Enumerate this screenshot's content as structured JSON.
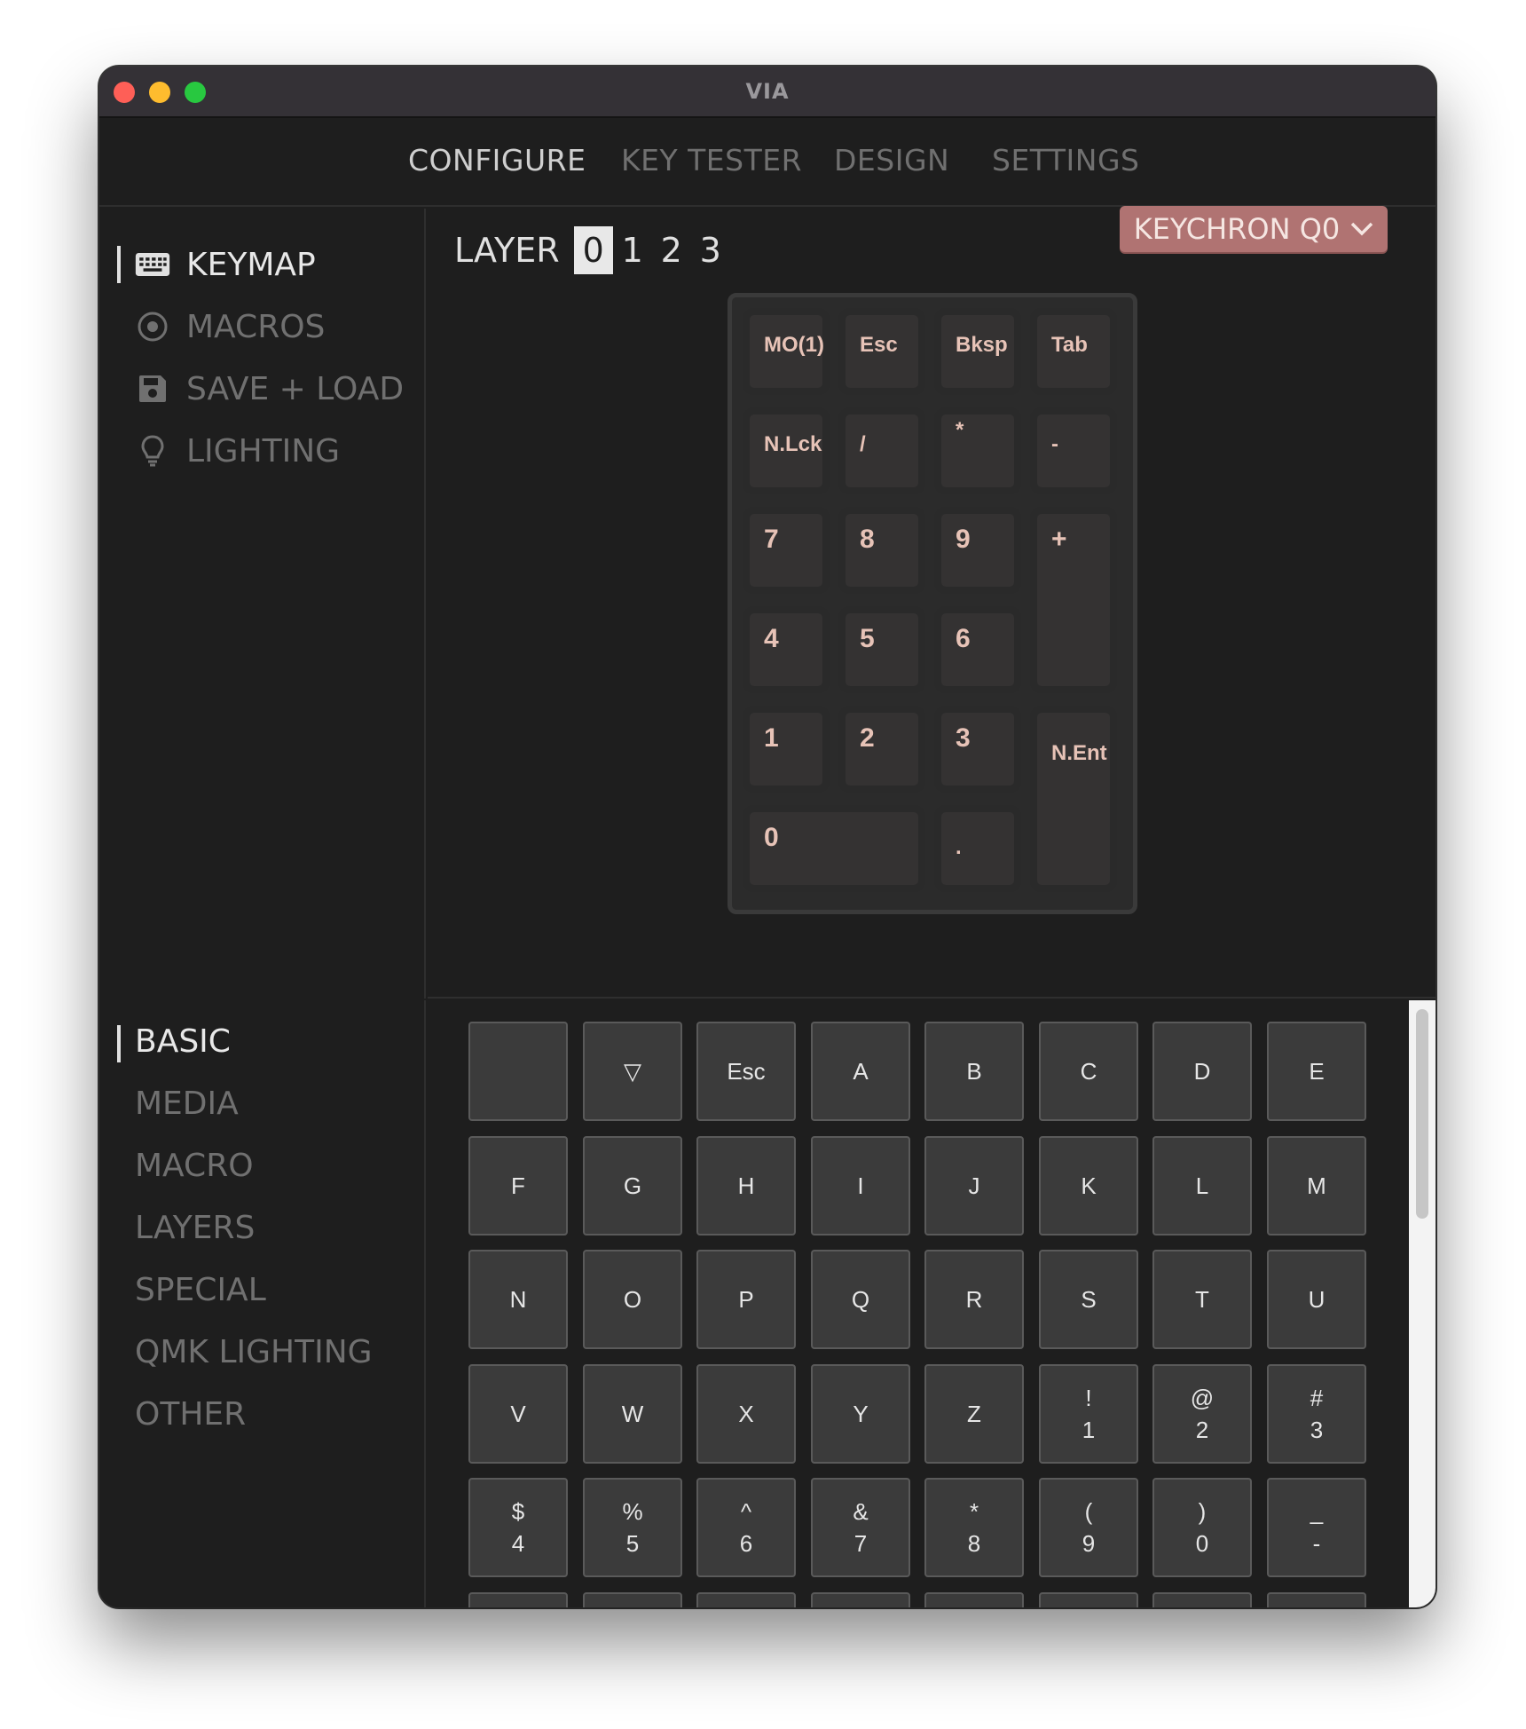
{
  "window": {
    "title": "VIA"
  },
  "topnav": {
    "tabs": [
      "CONFIGURE",
      "KEY TESTER",
      "DESIGN",
      "SETTINGS"
    ],
    "active": "CONFIGURE"
  },
  "sidebar": {
    "items": [
      {
        "label": "KEYMAP",
        "icon": "keyboard-icon",
        "active": true
      },
      {
        "label": "MACROS",
        "icon": "record-icon",
        "active": false
      },
      {
        "label": "SAVE + LOAD",
        "icon": "floppy-icon",
        "active": false
      },
      {
        "label": "LIGHTING",
        "icon": "bulb-icon",
        "active": false
      }
    ]
  },
  "layers": {
    "label": "LAYER",
    "items": [
      "0",
      "1",
      "2",
      "3"
    ],
    "selected": "0"
  },
  "device": {
    "label": "KEYCHRON Q0",
    "icon": "chevron-down-icon",
    "color": "#b07372"
  },
  "keymap": [
    "MO(1)",
    "Esc",
    "Bksp",
    "Tab",
    "N.Lck",
    "/",
    "*",
    "-",
    "7",
    "8",
    "9",
    "+",
    "4",
    "5",
    "6",
    "1",
    "2",
    "3",
    "N.Ent",
    "0",
    "."
  ],
  "categories": {
    "items": [
      "BASIC",
      "MEDIA",
      "MACRO",
      "LAYERS",
      "SPECIAL",
      "QMK LIGHTING",
      "OTHER"
    ],
    "active": "BASIC"
  },
  "keycodes": [
    [
      "",
      ""
    ],
    [
      "▽",
      ""
    ],
    [
      "Esc",
      ""
    ],
    [
      "A",
      ""
    ],
    [
      "B",
      ""
    ],
    [
      "C",
      ""
    ],
    [
      "D",
      ""
    ],
    [
      "E",
      ""
    ],
    [
      "F",
      ""
    ],
    [
      "G",
      ""
    ],
    [
      "H",
      ""
    ],
    [
      "I",
      ""
    ],
    [
      "J",
      ""
    ],
    [
      "K",
      ""
    ],
    [
      "L",
      ""
    ],
    [
      "M",
      ""
    ],
    [
      "N",
      ""
    ],
    [
      "O",
      ""
    ],
    [
      "P",
      ""
    ],
    [
      "Q",
      ""
    ],
    [
      "R",
      ""
    ],
    [
      "S",
      ""
    ],
    [
      "T",
      ""
    ],
    [
      "U",
      ""
    ],
    [
      "V",
      ""
    ],
    [
      "W",
      ""
    ],
    [
      "X",
      ""
    ],
    [
      "Y",
      ""
    ],
    [
      "Z",
      ""
    ],
    [
      "!",
      "1"
    ],
    [
      "@",
      "2"
    ],
    [
      "#",
      "3"
    ],
    [
      "$",
      "4"
    ],
    [
      "%",
      "5"
    ],
    [
      "^",
      "6"
    ],
    [
      "&",
      "7"
    ],
    [
      "*",
      "8"
    ],
    [
      "(",
      "9"
    ],
    [
      ")",
      "0"
    ],
    [
      "_",
      "-"
    ]
  ]
}
